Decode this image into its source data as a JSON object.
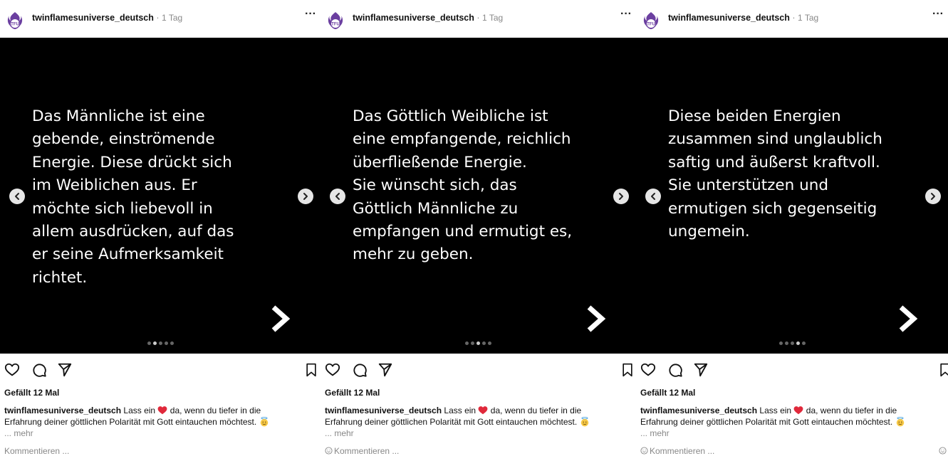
{
  "posts": [
    {
      "username": "twinflamesuniverse_deutsch",
      "separator": "·",
      "time": "1 Tag",
      "slide_text": "Das Männliche ist eine\ngebende, einströmende\nEnergie. Diese drückt sich\nim Weiblichen aus. Er\nmöchte sich liebevoll in\nallem ausdrücken, auf das\ner seine Aufmerksamkeit\nrichtet.",
      "likes": "Gefällt 12 Mal",
      "caption_user": "twinflamesuniverse_deutsch",
      "caption_pre": " Lass ein ",
      "caption_post": " da, wenn du tiefer in die Erfahrung deiner göttlichen Polarität mit Gott eintauchen möchtest. ",
      "more": "... mehr",
      "comment_placeholder": "Kommentieren ...",
      "active_dot": 1
    },
    {
      "username": "twinflamesuniverse_deutsch",
      "separator": "·",
      "time": "1 Tag",
      "slide_text": "Das Göttlich Weibliche ist\neine empfangende, reichlich\nüberfließende Energie.\nSie wünscht sich, das\nGöttlich Männliche zu\nempfangen und ermutigt es,\nmehr zu geben.",
      "likes": "Gefällt 12 Mal",
      "caption_user": "twinflamesuniverse_deutsch",
      "caption_pre": " Lass ein ",
      "caption_post": " da, wenn du tiefer in die Erfahrung deiner göttlichen Polarität mit Gott eintauchen möchtest. ",
      "more": "... mehr",
      "comment_placeholder": "Kommentieren ...",
      "active_dot": 2
    },
    {
      "username": "twinflamesuniverse_deutsch",
      "separator": "·",
      "time": "1 Tag",
      "slide_text": "Diese beiden Energien\nzusammen sind unglaublich\nsaftig und äußerst kraftvoll.\nSie unterstützen und\nermutigen sich gegenseitig\nungemein.",
      "likes": "Gefällt 12 Mal",
      "caption_user": "twinflamesuniverse_deutsch",
      "caption_pre": " Lass ein ",
      "caption_post": " da, wenn du tiefer in die Erfahrung deiner göttlichen Polarität mit Gott eintauchen möchtest. ",
      "more": "... mehr",
      "comment_placeholder": "Kommentieren ...",
      "active_dot": 3
    }
  ],
  "colors": {
    "slide_bg": "#000000",
    "slide_text": "#ffffff",
    "heart": "#e0293b",
    "avatar_accent": "#6b3fa0"
  },
  "icons": {
    "avatar": "avatar-icon",
    "more": "more-options-icon",
    "prev": "chevron-left-icon",
    "next": "chevron-right-icon",
    "like": "heart-outline-icon",
    "comment": "comment-icon",
    "share": "paper-plane-icon",
    "save": "bookmark-icon",
    "emoji": "smiley-icon"
  },
  "dot_count": 5
}
